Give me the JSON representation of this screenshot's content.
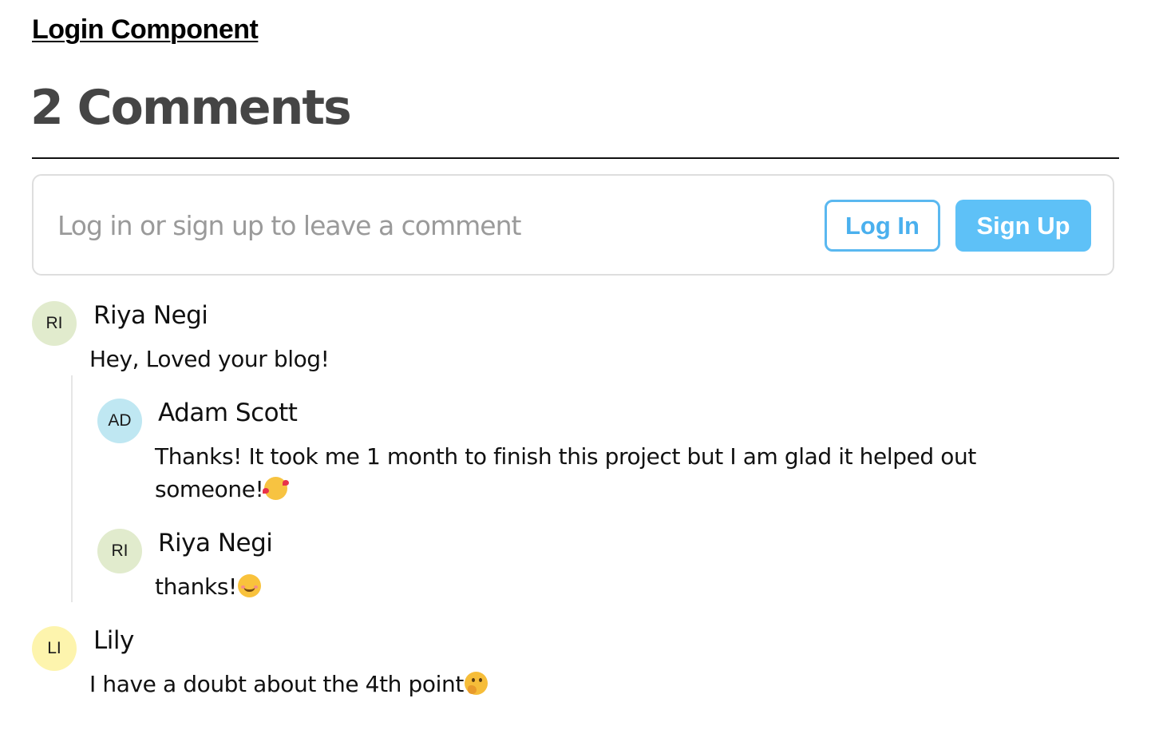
{
  "header": {
    "link_label": "Login Component",
    "comments_heading": "2 Comments"
  },
  "comment_box": {
    "prompt": "Log in or sign up to leave a comment",
    "login_label": "Log In",
    "signup_label": "Sign Up",
    "accent_color": "#5ec1f7"
  },
  "comments": [
    {
      "initials": "RI",
      "author": "Riya Negi",
      "text": "Hey, Loved your blog!",
      "avatar_color": "#e1ebcd",
      "replies": [
        {
          "initials": "AD",
          "author": "Adam Scott",
          "text": "Thanks! It took me 1 month to finish this project but I am glad it helped out someone!",
          "emoji_icon": "smiling-face-with-hearts-icon",
          "avatar_color": "#bfe7f2"
        },
        {
          "initials": "RI",
          "author": "Riya Negi",
          "text": "thanks!",
          "emoji_icon": "smiling-face-icon",
          "avatar_color": "#e1ebcd"
        }
      ]
    },
    {
      "initials": "LI",
      "author": "Lily",
      "text": "I have a doubt about the 4th point",
      "emoji_icon": "thinking-face-icon",
      "avatar_color": "#fdf4ad",
      "replies": []
    }
  ]
}
